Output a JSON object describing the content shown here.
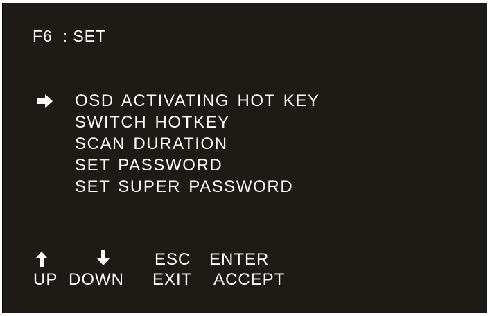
{
  "osd": {
    "title": "F6  : SET",
    "menu": {
      "items": [
        "OSD ACTIVATING HOT KEY",
        "SWITCH HOTKEY",
        "SCAN DURATION",
        "SET PASSWORD",
        "SET SUPER PASSWORD"
      ],
      "selected_index": 0,
      "selector_icon": "right-arrow-icon"
    },
    "keys": {
      "up": {
        "icon": "up-arrow-icon",
        "label": "UP"
      },
      "down": {
        "icon": "down-arrow-icon",
        "label": "DOWN"
      },
      "exit": {
        "key": "ESC",
        "label": "EXIT"
      },
      "accept": {
        "key": "ENTER",
        "label": "ACCEPT"
      }
    },
    "colors": {
      "background": "#1e1b16",
      "text": "#ffffff"
    }
  }
}
